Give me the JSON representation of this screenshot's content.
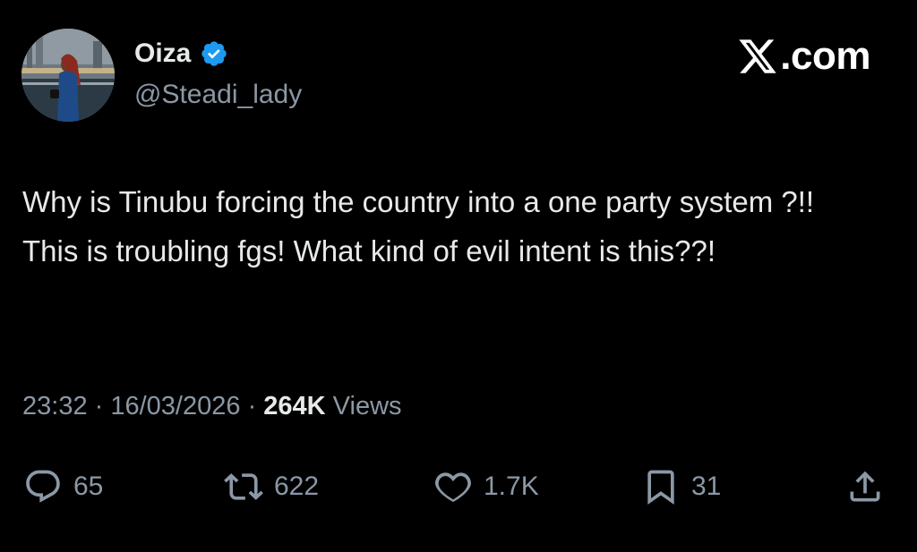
{
  "author": {
    "display_name": "Oiza",
    "handle": "@Steadi_lady",
    "verified": true,
    "verified_color": "#1d9bf0"
  },
  "brand": {
    "label": ".com",
    "logo_icon": "x-logo-icon"
  },
  "tweet": {
    "lines": [
      "Why is Tinubu forcing the country into a one party system ?!!",
      "This is troubling fgs! What kind of evil intent is this??!"
    ]
  },
  "meta": {
    "time": "23:32",
    "separator": " · ",
    "date": "16/03/2026",
    "views_count": "264K",
    "views_label": " Views"
  },
  "actions": {
    "reply": {
      "icon": "reply-icon",
      "count": "65"
    },
    "repost": {
      "icon": "repost-icon",
      "count": "622"
    },
    "like": {
      "icon": "heart-icon",
      "count": "1.7K"
    },
    "bookmark": {
      "icon": "bookmark-icon",
      "count": "31"
    },
    "share": {
      "icon": "share-icon"
    }
  },
  "colors": {
    "background": "#000000",
    "primary_text": "#e7e9ea",
    "secondary_text": "#8b98a5",
    "verified": "#1d9bf0"
  }
}
